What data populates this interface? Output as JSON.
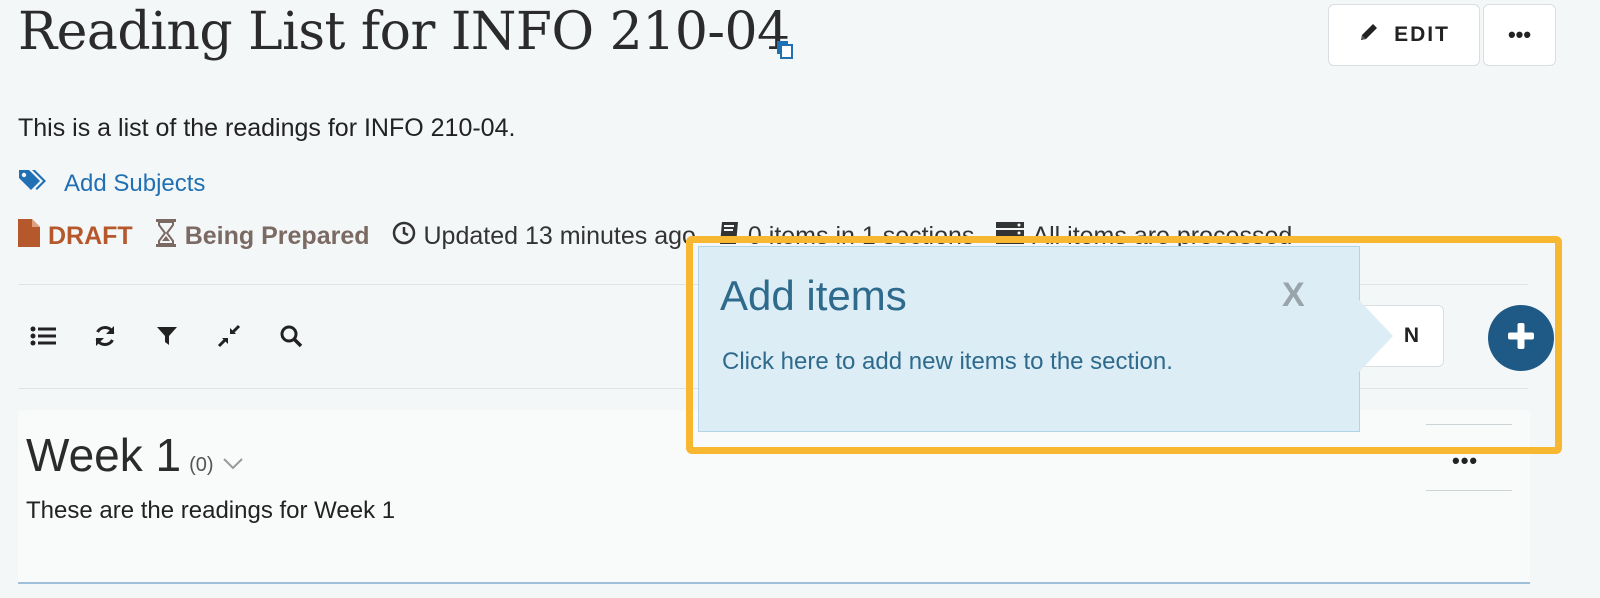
{
  "header": {
    "title": "Reading List for INFO 210-04",
    "edit_label": "EDIT",
    "more_label": "•••"
  },
  "description": "This is a list of the readings for INFO 210-04.",
  "subjects_link": "Add Subjects",
  "status": {
    "draft": "DRAFT",
    "state": "Being Prepared",
    "updated": "Updated 13 minutes ago",
    "items": "0 items in 1 sections",
    "processed": "All items are processed"
  },
  "toolbar": {
    "section_button_label": "N"
  },
  "section": {
    "title": "Week 1",
    "count": "(0)",
    "description": "These are the readings for Week 1",
    "more_label": "•••"
  },
  "popover": {
    "title": "Add items",
    "close": "X",
    "text": "Click here to add new items to the section."
  },
  "colors": {
    "accent": "#2170b3",
    "draft": "#b5582c",
    "prepared": "#7b6a63",
    "highlight": "#f7b731",
    "popover_bg": "#dcedf6",
    "plus_button": "#1f5a87"
  }
}
